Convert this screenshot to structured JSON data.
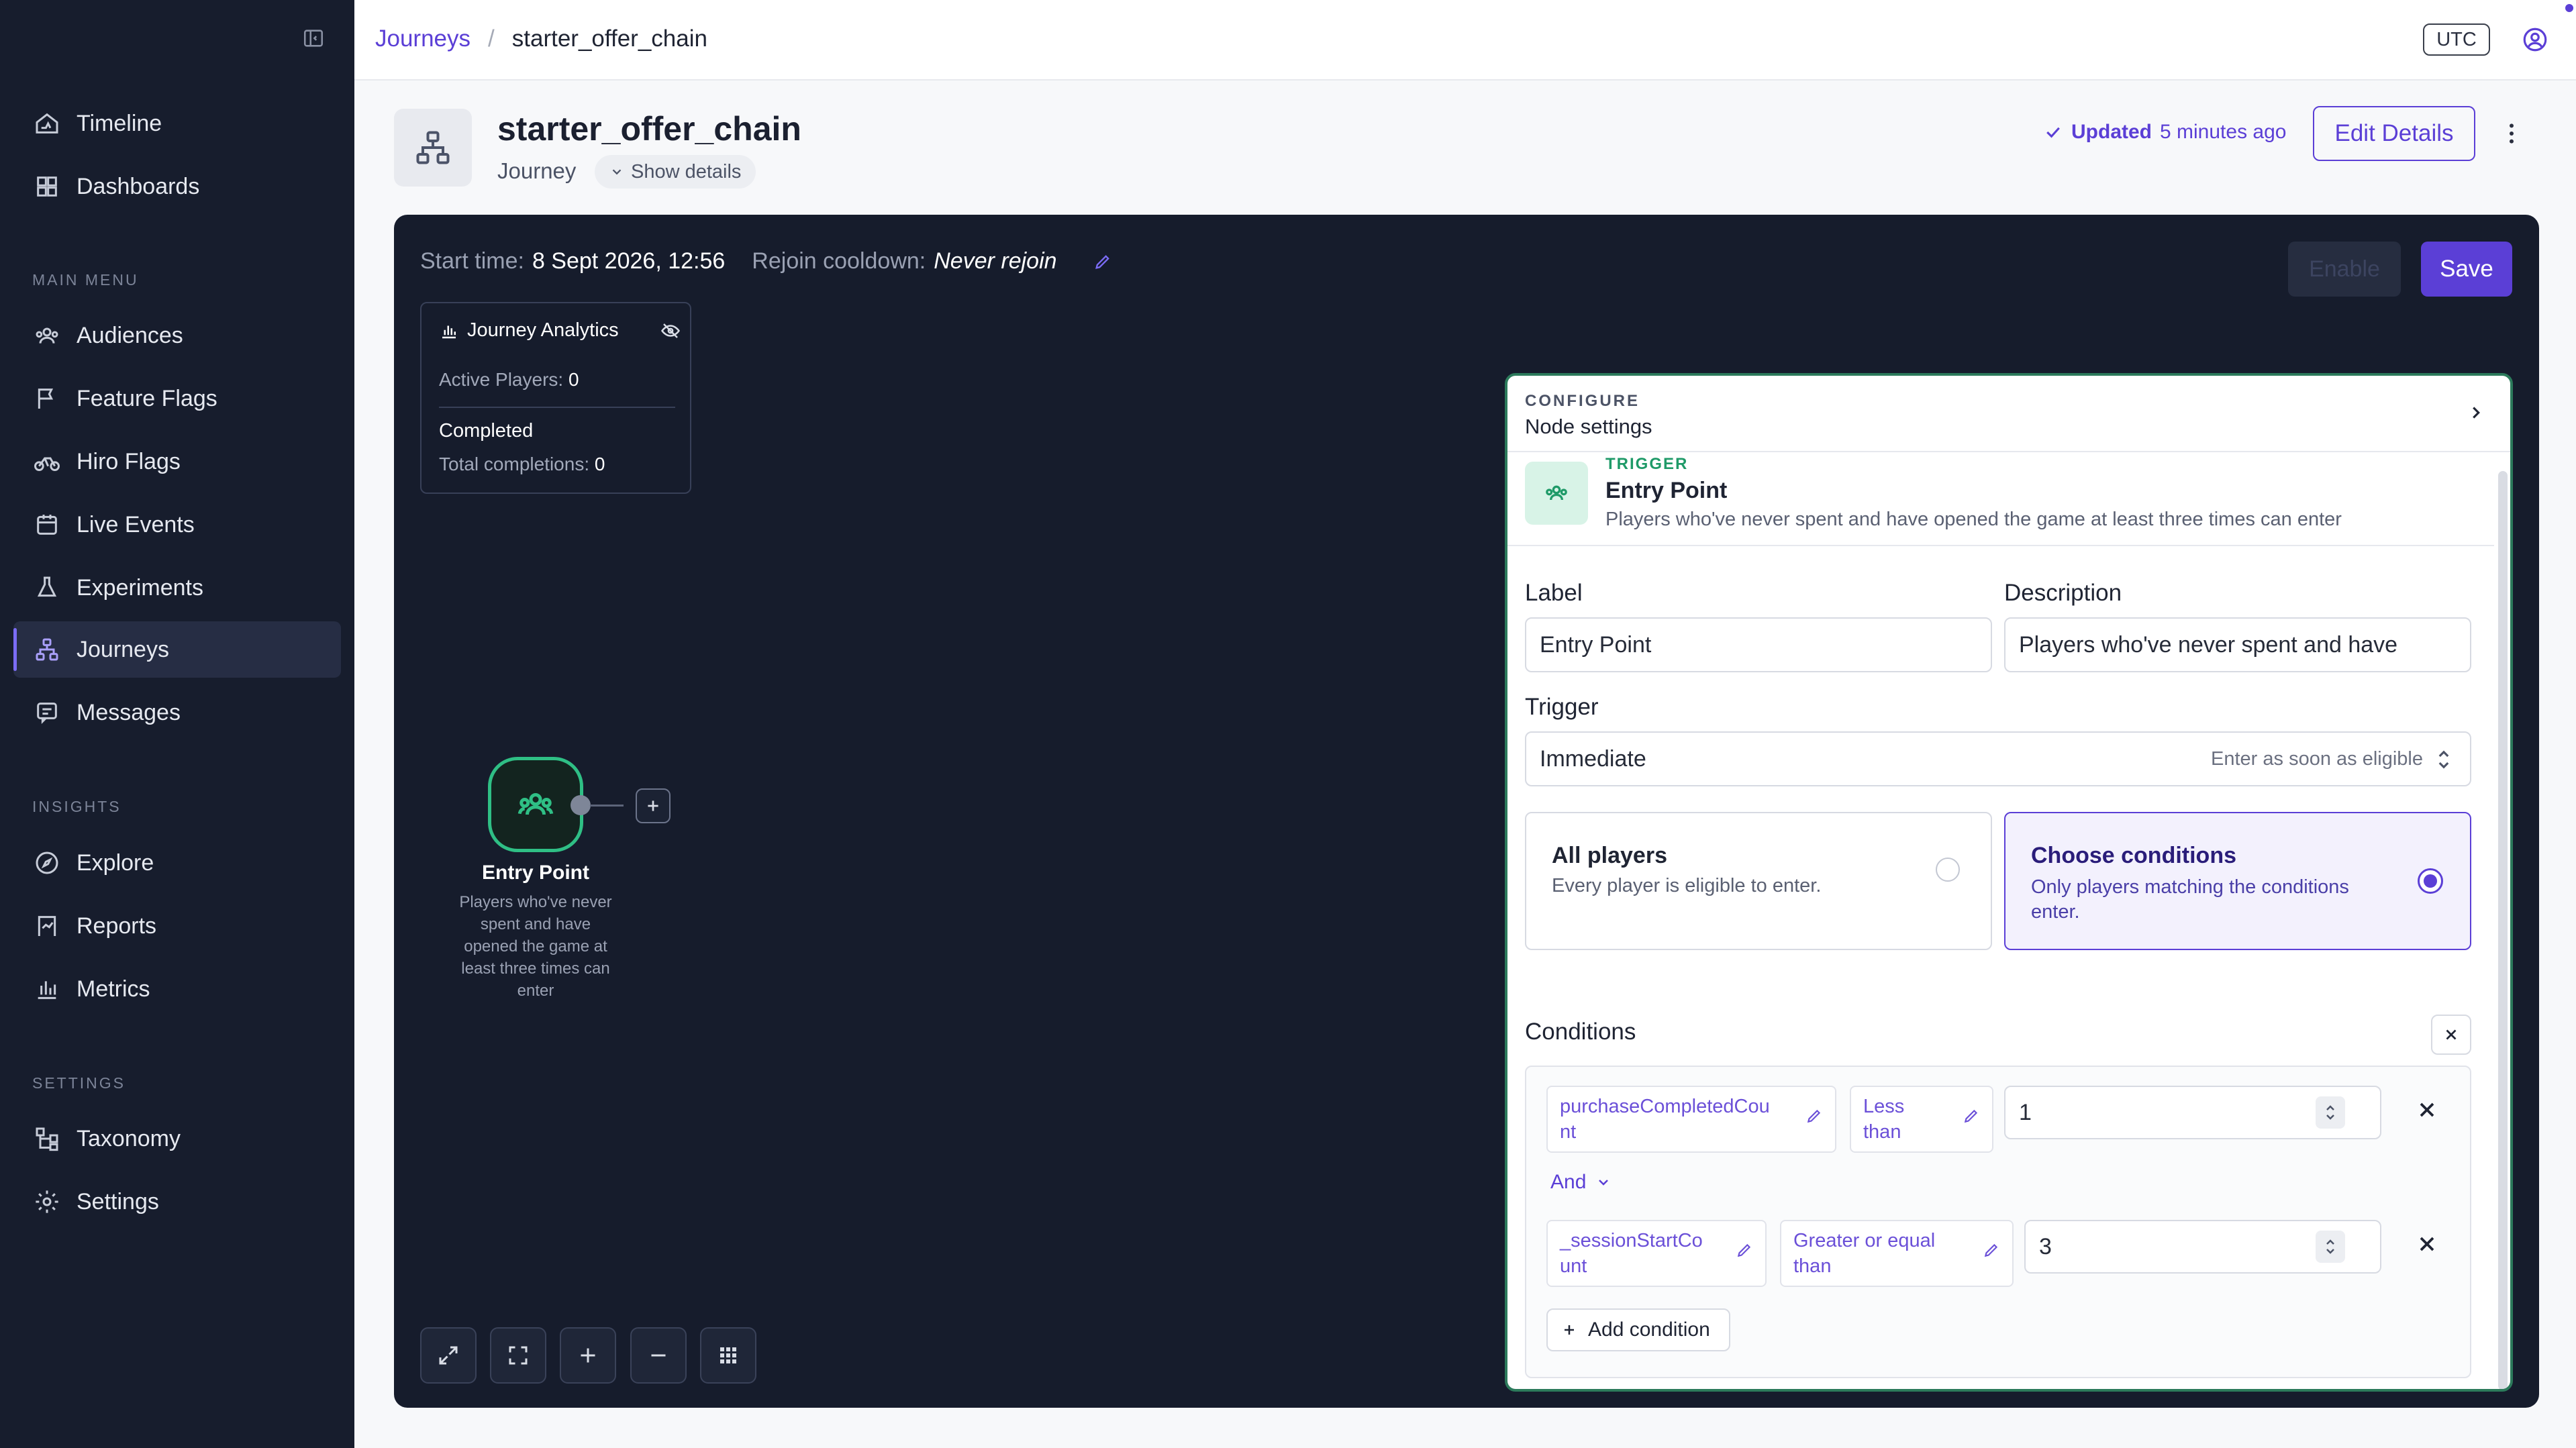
{
  "sidebar": {
    "top_items": [
      {
        "label": "Timeline",
        "icon": "timeline-icon"
      },
      {
        "label": "Dashboards",
        "icon": "dashboard-icon"
      }
    ],
    "main_menu_title": "MAIN MENU",
    "main_items": [
      {
        "label": "Audiences",
        "icon": "users-icon"
      },
      {
        "label": "Feature Flags",
        "icon": "flag-icon"
      },
      {
        "label": "Hiro Flags",
        "icon": "bike-icon"
      },
      {
        "label": "Live Events",
        "icon": "calendar-icon"
      },
      {
        "label": "Experiments",
        "icon": "flask-icon"
      },
      {
        "label": "Journeys",
        "icon": "journey-icon"
      },
      {
        "label": "Messages",
        "icon": "message-icon"
      }
    ],
    "insights_title": "INSIGHTS",
    "insights_items": [
      {
        "label": "Explore",
        "icon": "compass-icon"
      },
      {
        "label": "Reports",
        "icon": "report-icon"
      },
      {
        "label": "Metrics",
        "icon": "metrics-icon"
      }
    ],
    "settings_title": "SETTINGS",
    "settings_items": [
      {
        "label": "Taxonomy",
        "icon": "taxonomy-icon"
      },
      {
        "label": "Settings",
        "icon": "gear-icon"
      }
    ]
  },
  "breadcrumb": {
    "parent": "Journeys",
    "separator": "/",
    "current": "starter_offer_chain"
  },
  "topbar": {
    "timezone": "UTC"
  },
  "header": {
    "title": "starter_offer_chain",
    "subtitle": "Journey",
    "show_details": "Show details",
    "updated_label": "Updated",
    "updated_time": "5 minutes ago",
    "edit_button": "Edit Details"
  },
  "canvas": {
    "start_time_label": "Start time:",
    "start_time_value": "8 Sept 2026, 12:56",
    "cooldown_label": "Rejoin cooldown:",
    "cooldown_value": "Never rejoin",
    "enable_button": "Enable",
    "save_button": "Save",
    "analytics": {
      "title": "Journey Analytics",
      "active_label": "Active Players:",
      "active_value": "0",
      "completed_title": "Completed",
      "total_label": "Total completions:",
      "total_value": "0"
    },
    "node": {
      "label": "Entry Point",
      "description": "Players who've never spent and have opened the game at least three times can enter",
      "desc_lines": [
        "Players who've never",
        "spent and have",
        "opened the game at",
        "least three times can",
        "enter"
      ]
    }
  },
  "panel": {
    "configure_label": "CONFIGURE",
    "title": "Node settings",
    "trigger_tag": "TRIGGER",
    "trigger_name": "Entry Point",
    "trigger_desc": "Players who've never spent and have opened the game at least three times can enter",
    "label_title": "Label",
    "label_value": "Entry Point",
    "description_title": "Description",
    "description_value": "Players who've never spent and have",
    "trigger_title": "Trigger",
    "trigger_select_value": "Immediate",
    "trigger_select_hint": "Enter as soon as eligible",
    "option_all": {
      "title": "All players",
      "desc": "Every player is eligible to enter.",
      "selected": false
    },
    "option_choose": {
      "title": "Choose conditions",
      "desc_line1": "Only players matching the conditions",
      "desc_line2": "enter.",
      "selected": true
    },
    "conditions_title": "Conditions",
    "conditions": [
      {
        "field_l1": "purchaseCompletedCou",
        "field_l2": "nt",
        "op_l1": "Less",
        "op_l2": "than",
        "value": "1"
      },
      {
        "field_l1": "_sessionStartCo",
        "field_l2": "unt",
        "op_l1": "Greater or equal",
        "op_l2": "than",
        "value": "3"
      }
    ],
    "joiner": "And",
    "add_condition": "Add condition"
  },
  "colors": {
    "accent": "#5b3fd6",
    "sidebar_bg": "#171d2d",
    "canvas_bg": "#161c2c",
    "node_green": "#2fbf85"
  }
}
